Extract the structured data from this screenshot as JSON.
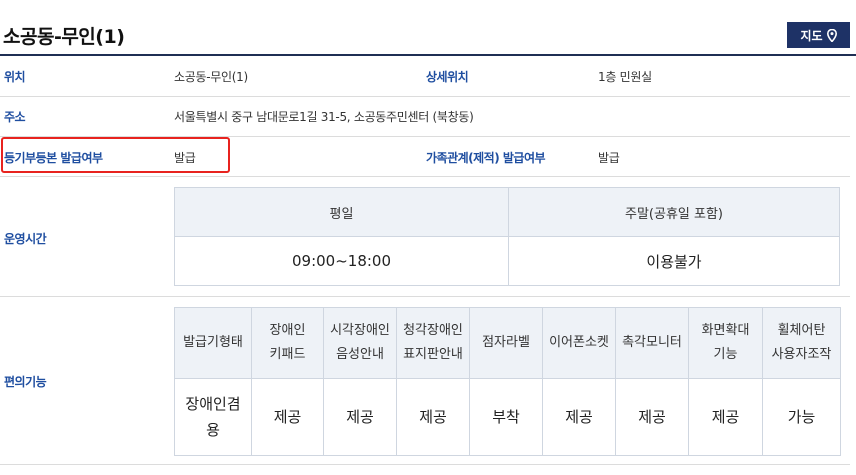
{
  "header": {
    "title": "소공동-무인(1)",
    "map_button_label": "지도",
    "map_icon": "map-pin-icon"
  },
  "info": {
    "location_label": "위치",
    "location_value": "소공동-무인(1)",
    "detail_location_label": "상세위치",
    "detail_location_value": "1층 민원실",
    "address_label": "주소",
    "address_value": "서울특별시 중구 남대문로1길 31-5, 소공동주민센터 (북창동)",
    "registry_label": "등기부등본 발급여부",
    "registry_value": "발급",
    "family_label": "가족관계(제적) 발급여부",
    "family_value": "발급"
  },
  "hours": {
    "label": "운영시간",
    "headers": [
      "평일",
      "주말(공휴일 포함)"
    ],
    "values": [
      "09:00~18:00",
      "이용불가"
    ]
  },
  "convenience": {
    "label": "편의기능",
    "headers": [
      "발급기형태",
      "장애인\n키패드",
      "시각장애인\n음성안내",
      "청각장애인\n표지판안내",
      "점자라벨",
      "이어폰소켓",
      "촉각모니터",
      "화면확대\n기능",
      "휠체어탄\n사용자조작"
    ],
    "values": [
      "장애인겸\n용",
      "제공",
      "제공",
      "제공",
      "부착",
      "제공",
      "제공",
      "제공",
      "가능"
    ]
  },
  "colors": {
    "accent_navy": "#1e3266",
    "label_blue": "#1f4ea0",
    "highlight_red": "#e8231f",
    "table_header_bg": "#eef2f7"
  }
}
